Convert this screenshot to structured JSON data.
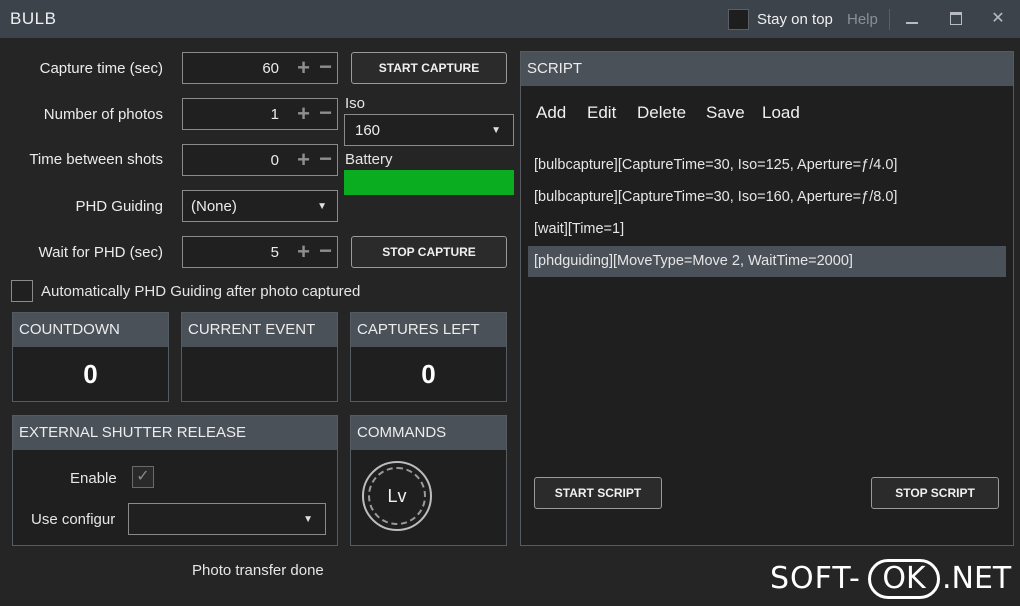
{
  "app": {
    "title": "BULB"
  },
  "titlebar": {
    "stay_on_top": "Stay on top",
    "help": "Help",
    "minimize": "–",
    "maximize": "■",
    "close": "✕"
  },
  "settings": {
    "capture_time": {
      "label": "Capture time (sec)",
      "value": "60"
    },
    "num_photos": {
      "label": "Number of photos",
      "value": "1"
    },
    "time_between": {
      "label": "Time between shots",
      "value": "0"
    },
    "phd_guiding": {
      "label": "PHD Guiding",
      "value": "(None)"
    },
    "wait_phd": {
      "label": "Wait for PHD (sec)",
      "value": "5"
    },
    "auto_phd": {
      "label": "Automatically PHD Guiding after photo captured"
    }
  },
  "buttons": {
    "start_capture": "START CAPTURE",
    "stop_capture": "STOP CAPTURE",
    "start_script": "START SCRIPT",
    "stop_script": "STOP SCRIPT"
  },
  "iso": {
    "label": "Iso",
    "value": "160"
  },
  "battery": {
    "label": "Battery",
    "level": 1.0,
    "color": "#0aad1f"
  },
  "counters": {
    "countdown": {
      "title": "COUNTDOWN",
      "value": "0"
    },
    "current_event": {
      "title": "CURRENT EVENT",
      "value": ""
    },
    "captures_left": {
      "title": "CAPTURES LEFT",
      "value": "0"
    }
  },
  "external_shutter": {
    "title": "EXTERNAL SHUTTER RELEASE",
    "enable_label": "Enable",
    "config_label": "Use configur",
    "config_value": ""
  },
  "commands": {
    "title": "COMMANDS",
    "lv": "Lv"
  },
  "script": {
    "title": "SCRIPT",
    "toolbar": [
      "Add",
      "Edit",
      "Delete",
      "Save",
      "Load"
    ],
    "lines": [
      "[bulbcapture][CaptureTime=30, Iso=125, Aperture=ƒ/4.0]",
      "[bulbcapture][CaptureTime=30, Iso=160, Aperture=ƒ/8.0]",
      "[wait][Time=1]",
      "[phdguiding][MoveType=Move 2, WaitTime=2000]"
    ],
    "selected_index": 3
  },
  "status": {
    "text": "Photo transfer done"
  },
  "watermark": {
    "text": "SOFT-OK.NET"
  }
}
